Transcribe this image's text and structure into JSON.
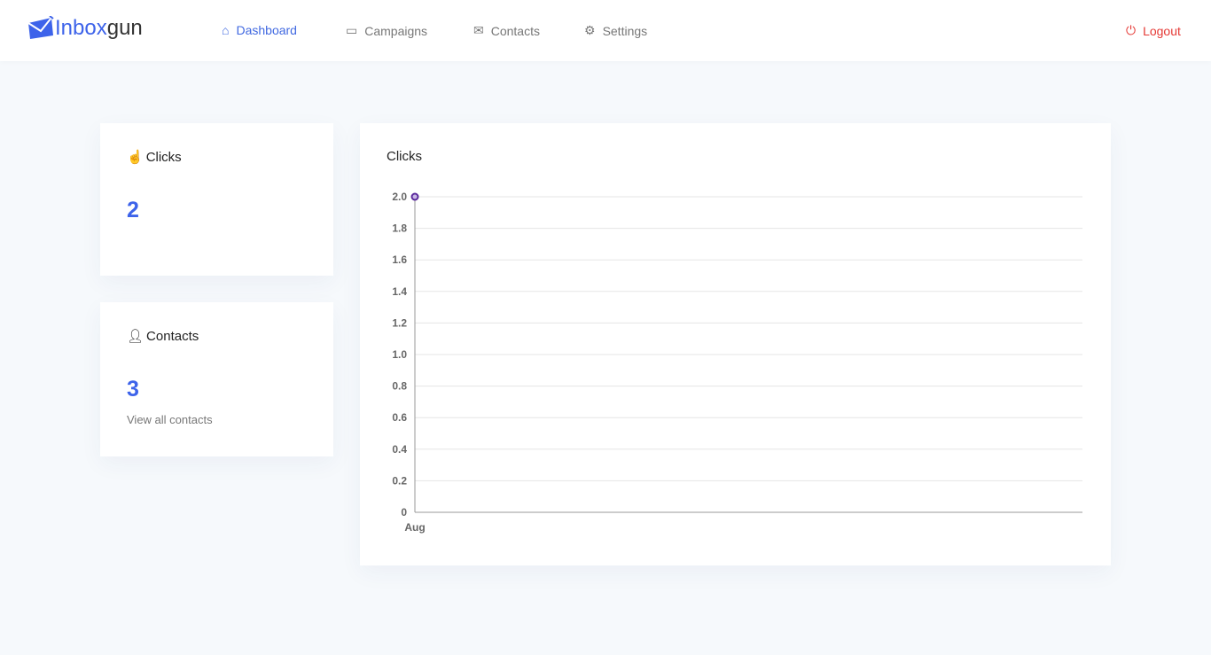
{
  "brand": {
    "part1": "Inbox",
    "part2": "gun"
  },
  "nav": {
    "dashboard": "Dashboard",
    "campaigns": "Campaigns",
    "contacts": "Contacts",
    "settings": "Settings",
    "logout": "Logout"
  },
  "cards": {
    "clicks": {
      "title": "Clicks",
      "value": "2"
    },
    "contacts": {
      "title": "Contacts",
      "value": "3",
      "link": "View all contacts"
    }
  },
  "chart_data": {
    "type": "line",
    "title": "Clicks",
    "categories": [
      "Aug"
    ],
    "values": [
      2
    ],
    "ylim": [
      0,
      2
    ],
    "yticks": [
      "0",
      "0.2",
      "0.4",
      "0.6",
      "0.8",
      "1.0",
      "1.2",
      "1.4",
      "1.6",
      "1.8",
      "2.0"
    ],
    "grid": true,
    "color": "#5b2a9c"
  }
}
